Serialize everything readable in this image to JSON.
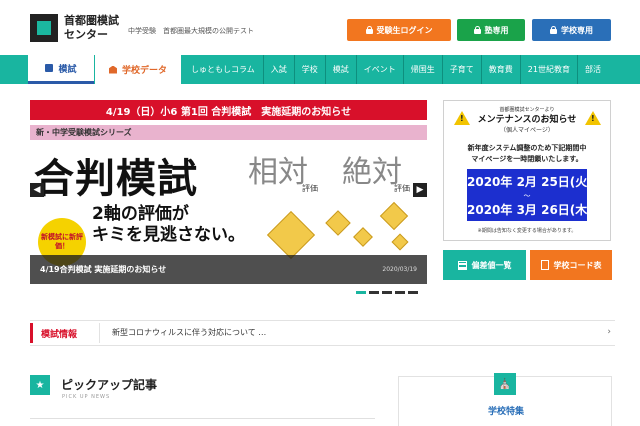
{
  "header": {
    "logo": "首都圏模試センター",
    "tagline": "中学受験　首都圏最大規模の公開テスト",
    "buttons": {
      "login": "受験生ログイン",
      "juku": "塾専用",
      "school": "学校専用"
    },
    "colors": {
      "login": "#f2761f",
      "juku": "#1aa34a",
      "school": "#2a6fb8"
    }
  },
  "nav": {
    "tab_moshi": "模試",
    "tab_school_data": "学校データ",
    "links": [
      "しゅともしコラム",
      "入試",
      "学校",
      "模試",
      "イベント",
      "帰国生",
      "子育て",
      "教育費",
      "21世紀教育",
      "部活"
    ],
    "accent": "#19b5a0"
  },
  "banner": {
    "headline": "4/19（日）小6 第1回 合判模試　実施延期のお知らせ",
    "series": "新・中学受験模試シリーズ",
    "title": "合判模試",
    "relative": "相対",
    "absolute": "絶対",
    "eval": "評価",
    "axis_line1": "2軸の評価が",
    "axis_line2": "キミを見逃さない。",
    "seal": "新模試に新評価！",
    "caption": "4/19合判模試 実施延期のお知らせ",
    "caption_date": "2020/03/19",
    "prev_icon": "chevron-left-icon",
    "next_icon": "chevron-right-icon"
  },
  "maintenance": {
    "small": "首都圏模試センターより",
    "title": "メンテナンスのお知らせ",
    "sub": "（個人マイページ）",
    "body_line1": "新年度システム調整のため下記期間中",
    "body_line2": "マイページを一時閉鎖いたします。",
    "date_from": "2020年 2月 25日(火)",
    "date_sep": "〜",
    "date_to": "2020年 3月 26日(木)",
    "note": "※期間は告知なく変更する場合があります。"
  },
  "side_buttons": {
    "hensa": "偏差値一覧",
    "code": "学校コード表"
  },
  "news": {
    "label": "模試情報",
    "text": "新型コロナウィルスに伴う対応について …",
    "arrow": "›"
  },
  "pickup": {
    "title": "ピックアップ記事",
    "sub": "PICK UP NEWS",
    "icon": "star-icon"
  },
  "feature": {
    "title": "学校特集",
    "icon": "school-icon"
  }
}
